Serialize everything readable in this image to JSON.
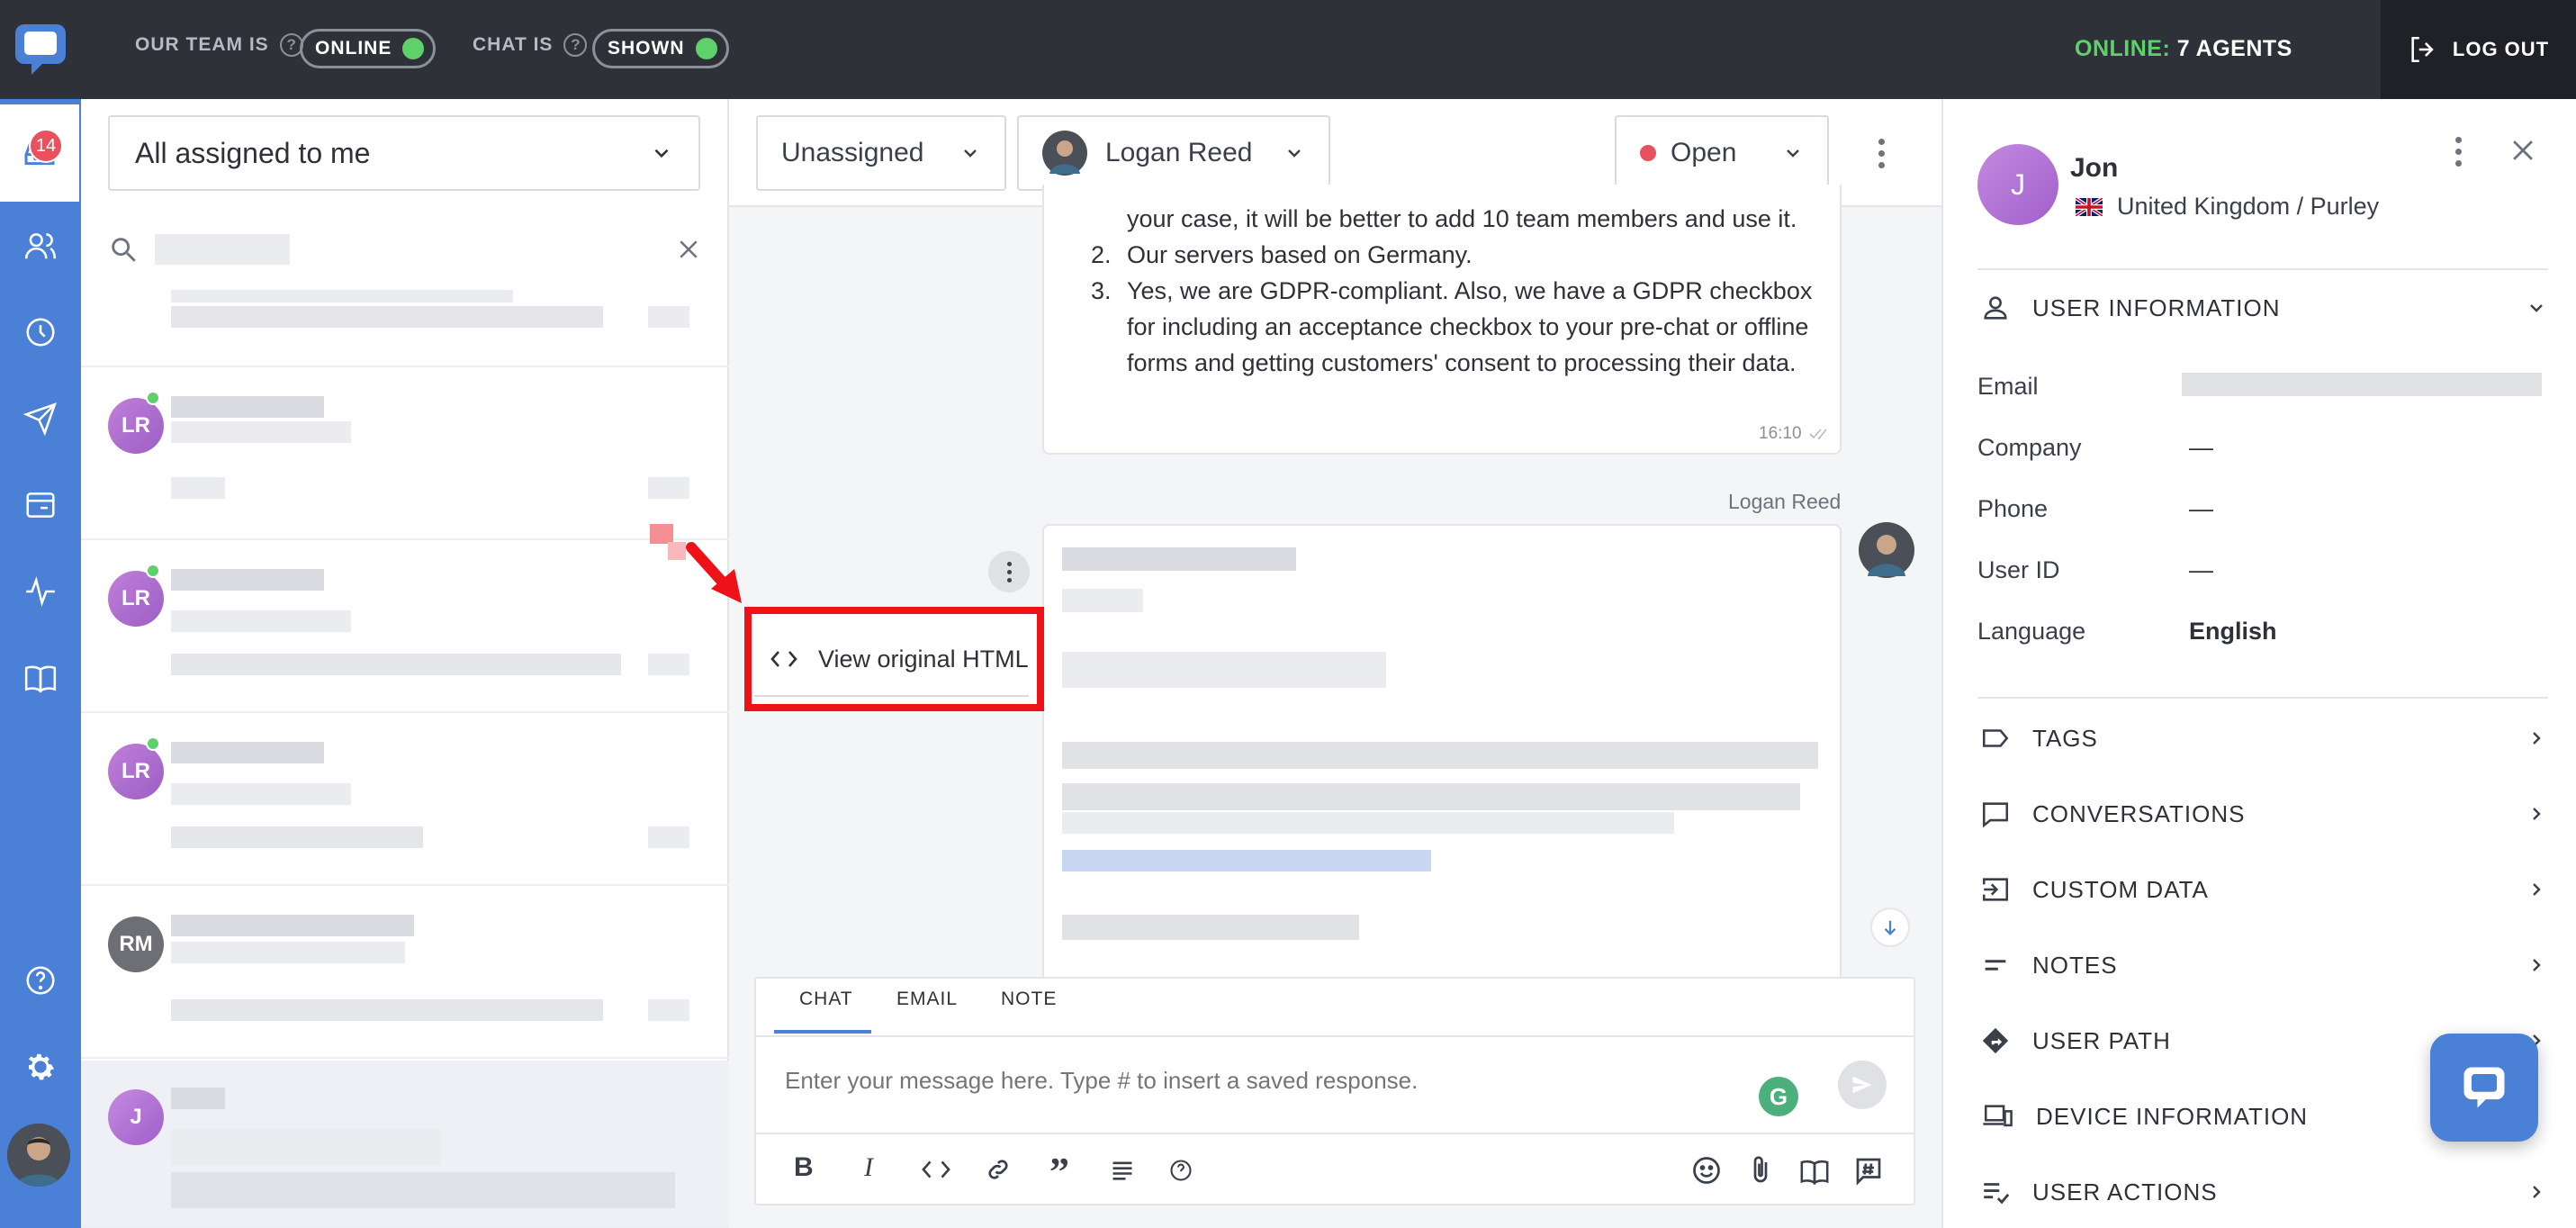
{
  "topbar": {
    "team_label": "OUR TEAM IS",
    "team_status": "ONLINE",
    "chat_label": "CHAT IS",
    "chat_status": "SHOWN",
    "online_label": "ONLINE:",
    "online_count": "7 AGENTS",
    "logout_label": "LOG OUT"
  },
  "nav": {
    "badge": "14",
    "items": [
      "inbox-icon",
      "users-icon",
      "clock-icon",
      "send-icon",
      "card-icon",
      "pulse-icon",
      "book-icon"
    ],
    "bottom": [
      "help-icon",
      "gear-icon"
    ]
  },
  "list": {
    "filter_label": "All assigned to me",
    "conversations": [
      {
        "initials": "LR",
        "online": true
      },
      {
        "initials": "LR",
        "online": true
      },
      {
        "initials": "LR",
        "online": true
      },
      {
        "initials": "RM",
        "online": false
      },
      {
        "initials": "J",
        "online": false
      }
    ]
  },
  "chat_header": {
    "assignee_group": "Unassigned",
    "assignee": "Logan Reed",
    "status": "Open"
  },
  "messages": {
    "answer_fragment": "your case, it will be better to add 10 team members and use it.",
    "item_2": "Our servers based on Germany.",
    "item_3": "Yes, we are GDPR-compliant. Also, we have a GDPR checkbox for including an acceptance checkbox to your pre-chat or offline forms and getting customers' consent to processing their data.",
    "item_2_num": "2.",
    "item_3_num": "3.",
    "time": "16:10",
    "sender": "Logan Reed",
    "view_html_label": "View original HTML"
  },
  "composer": {
    "tabs": [
      "CHAT",
      "EMAIL",
      "NOTE"
    ],
    "placeholder": "Enter your message here. Type # to insert a saved response."
  },
  "user": {
    "initial": "J",
    "name": "Jon",
    "location": "United Kingdom / Purley",
    "section_title": "USER INFORMATION",
    "fields": [
      {
        "label": "Email",
        "value": ""
      },
      {
        "label": "Company",
        "value": "—"
      },
      {
        "label": "Phone",
        "value": "—"
      },
      {
        "label": "User ID",
        "value": "—"
      },
      {
        "label": "Language",
        "value": "English"
      }
    ],
    "sections": [
      "TAGS",
      "CONVERSATIONS",
      "CUSTOM DATA",
      "NOTES",
      "USER PATH",
      "DEVICE INFORMATION",
      "USER ACTIONS"
    ]
  },
  "colors": {
    "accent": "#4a80d6",
    "topbar": "#2e3138",
    "online_green": "#5ed16b",
    "highlight_red": "#ee1118"
  }
}
